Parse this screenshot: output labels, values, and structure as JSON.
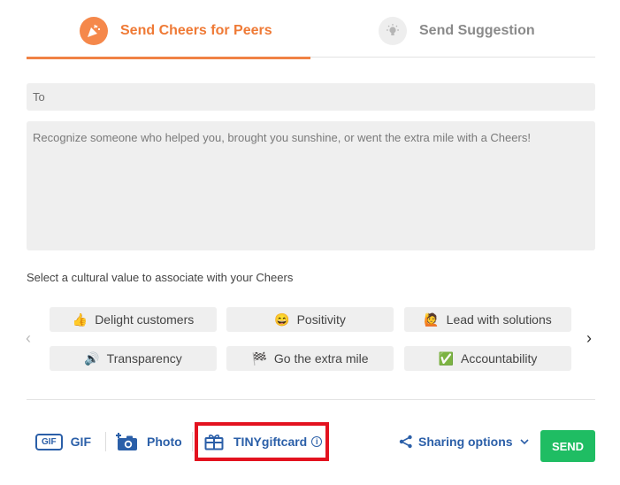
{
  "tabs": {
    "cheers": {
      "label": "Send Cheers for Peers",
      "icon": "party-popper-icon",
      "active": true,
      "color": "#ef7a36"
    },
    "suggestion": {
      "label": "Send Suggestion",
      "icon": "lightbulb-icon",
      "active": false
    }
  },
  "form": {
    "to_placeholder": "To",
    "message_placeholder": "Recognize someone who helped you, brought you sunshine, or went the extra mile with a Cheers!"
  },
  "values": {
    "label": "Select a cultural value to associate with your Cheers",
    "items": [
      {
        "emoji": "👍",
        "label": "Delight customers"
      },
      {
        "emoji": "😄",
        "label": "Positivity"
      },
      {
        "emoji": "🙋",
        "label": "Lead with solutions"
      },
      {
        "emoji": "🔊",
        "label": "Transparency"
      },
      {
        "emoji": "🏁",
        "label": "Go the extra mile"
      },
      {
        "emoji": "✅",
        "label": "Accountability"
      }
    ]
  },
  "toolbar": {
    "gif_icon_text": "GIF",
    "gif_label": "GIF",
    "photo_label": "Photo",
    "gift_label": "TINYgiftcard",
    "info_glyph": "i",
    "sharing_label": "Sharing options",
    "send_label": "SEND"
  },
  "colors": {
    "accent_orange": "#f08244",
    "link_blue": "#2b5fa8",
    "send_green": "#1fbd63",
    "highlight_red": "#e3121f"
  }
}
